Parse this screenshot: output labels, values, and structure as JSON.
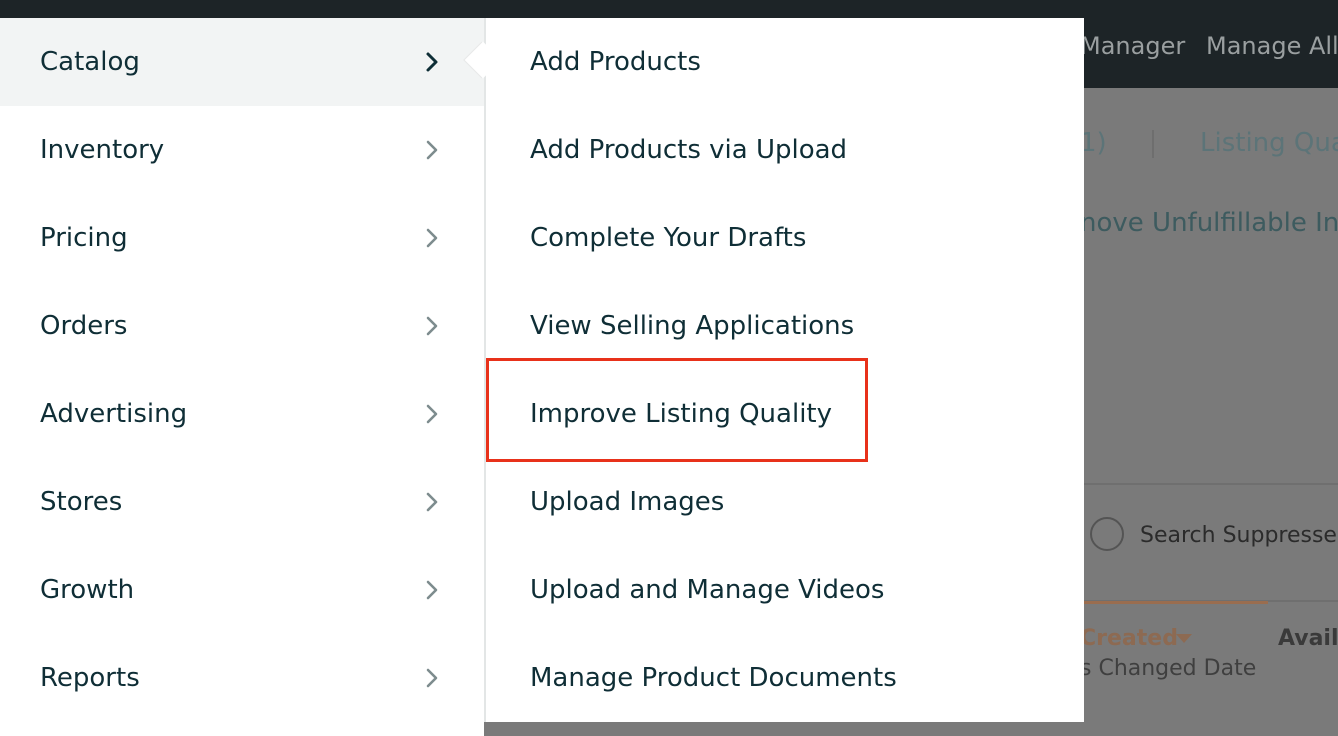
{
  "background_page": {
    "top_nav": [
      "Manager",
      "Manage All"
    ],
    "tabs": [
      "1)",
      "Listing Qua"
    ],
    "link": "nove Unfulfillable In",
    "filter_label": "Search Suppressed",
    "columns": {
      "created": "Created",
      "available": "Availa",
      "changed_date": "s Changed Date"
    }
  },
  "left_menu": {
    "items": [
      {
        "label": "Catalog",
        "active": true
      },
      {
        "label": "Inventory"
      },
      {
        "label": "Pricing"
      },
      {
        "label": "Orders"
      },
      {
        "label": "Advertising"
      },
      {
        "label": "Stores"
      },
      {
        "label": "Growth"
      },
      {
        "label": "Reports"
      }
    ],
    "chevron_icon": "chevron-right-icon"
  },
  "submenu": {
    "items": [
      {
        "label": "Add Products"
      },
      {
        "label": "Add Products via Upload"
      },
      {
        "label": "Complete Your Drafts"
      },
      {
        "label": "View Selling Applications"
      },
      {
        "label": "Improve Listing Quality",
        "highlighted": true
      },
      {
        "label": "Upload Images"
      },
      {
        "label": "Upload and Manage Videos"
      },
      {
        "label": "Manage Product Documents"
      }
    ]
  },
  "colors": {
    "highlight": "#e8311a",
    "text": "#0f2e36",
    "active_bg": "#f2f4f4",
    "top_bar": "#1d2427"
  }
}
